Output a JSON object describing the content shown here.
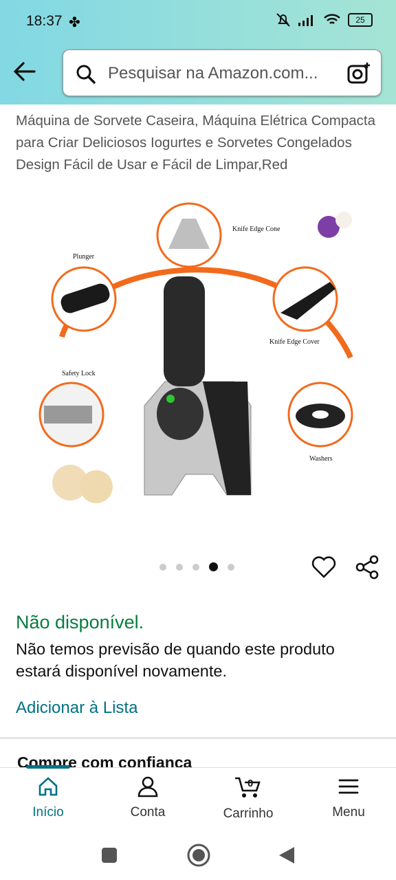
{
  "status_bar": {
    "time": "18:37",
    "battery": "25"
  },
  "search": {
    "placeholder": "Pesquisar na Amazon.com..."
  },
  "product": {
    "title": "Máquina de Sorvete Caseira, Máquina Elétrica Compacta para Criar Deliciosos Iogurtes e Sorvetes Congelados Design Fácil de Usar e Fácil de Limpar,Red",
    "image_labels": {
      "knife_edge_cone": "Knife Edge Cone",
      "plunger": "Plunger",
      "knife_edge_cover": "Knife Edge Cover",
      "safety_lock": "Safety Lock",
      "washers": "Washers"
    },
    "carousel": {
      "count": 5,
      "active_index": 3
    }
  },
  "availability": {
    "status": "Não disponível.",
    "message": "Não temos previsão de quando este produto estará disponível novamente."
  },
  "add_to_list": "Adicionar à Lista",
  "trust_heading": "Compre com confiança",
  "tabs": [
    {
      "label": "Início",
      "icon": "home-icon"
    },
    {
      "label": "Conta",
      "icon": "account-icon"
    },
    {
      "label": "Carrinho",
      "icon": "cart-icon",
      "badge": "0"
    },
    {
      "label": "Menu",
      "icon": "menu-icon"
    }
  ],
  "colors": {
    "accent": "#007185",
    "available_green": "#067d3f",
    "orange_arc": "#f26a1b"
  }
}
